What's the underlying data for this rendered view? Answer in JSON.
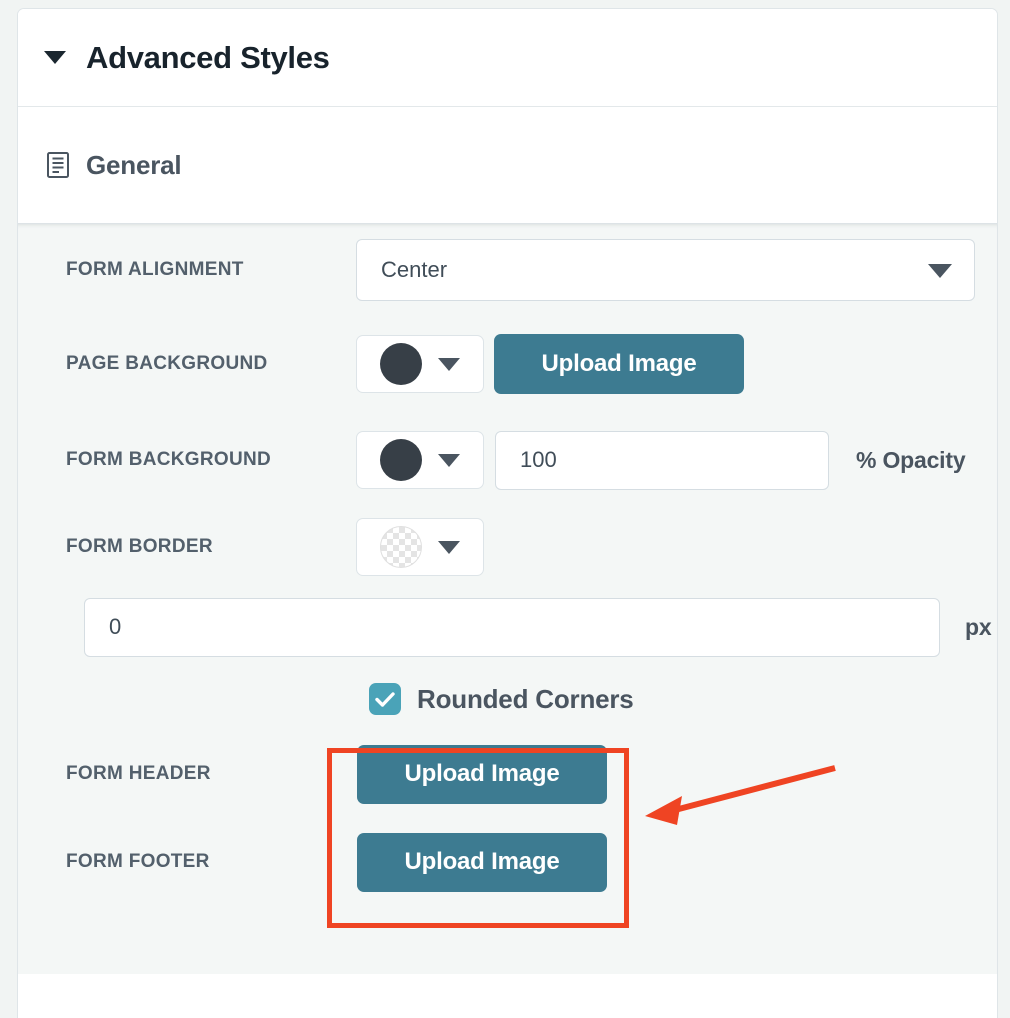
{
  "accordion": {
    "title": "Advanced Styles",
    "caret_icon": "caret-down-icon",
    "expanded": true
  },
  "section": {
    "icon": "document-lines-icon",
    "title": "General"
  },
  "colors": {
    "accent_teal": "#3d7b91",
    "checkbox_teal": "#4aa3b8",
    "annotation_red": "#ef4423",
    "label_slate": "#53606c",
    "swatch_dark": "#373f47",
    "panel_body_bg": "#f4f7f6"
  },
  "fields": {
    "form_alignment": {
      "label": "FORM ALIGNMENT",
      "value": "Center",
      "caret_icon": "caret-down-icon"
    },
    "page_background": {
      "label": "PAGE BACKGROUND",
      "swatch_color": "#373f47",
      "swatch_caret_icon": "caret-down-icon",
      "upload_label": "Upload Image"
    },
    "form_background": {
      "label": "FORM BACKGROUND",
      "swatch_color": "#373f47",
      "swatch_caret_icon": "caret-down-icon",
      "opacity_value": "100",
      "opacity_suffix": "% Opacity"
    },
    "form_border": {
      "label": "FORM BORDER",
      "swatch_color": "transparent",
      "swatch_caret_icon": "caret-down-icon",
      "width_value": "0",
      "width_suffix": "px"
    },
    "rounded_corners": {
      "label": "Rounded Corners",
      "checked": true,
      "check_icon": "checkmark-icon"
    },
    "form_header": {
      "label": "FORM HEADER",
      "upload_label": "Upload Image"
    },
    "form_footer": {
      "label": "FORM FOOTER",
      "upload_label": "Upload Image"
    }
  },
  "annotations": {
    "highlight_box": {
      "name": "upload-buttons-highlight",
      "color": "#ef4423"
    },
    "arrow": {
      "name": "pointer-arrow",
      "color": "#ef4423",
      "direction": "left"
    }
  }
}
